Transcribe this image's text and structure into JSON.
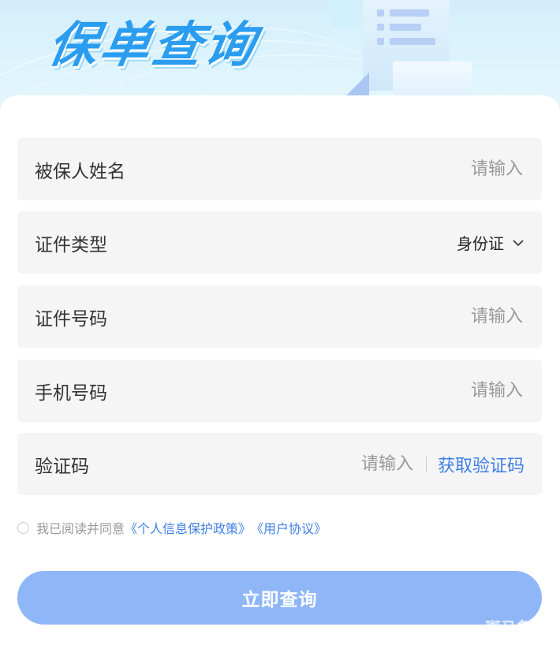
{
  "header": {
    "title": "保单查询"
  },
  "form": {
    "insured_name": {
      "label": "被保人姓名",
      "placeholder": "请输入"
    },
    "id_type": {
      "label": "证件类型",
      "value": "身份证"
    },
    "id_number": {
      "label": "证件号码",
      "placeholder": "请输入"
    },
    "phone": {
      "label": "手机号码",
      "placeholder": "请输入"
    },
    "verify_code": {
      "label": "验证码",
      "placeholder": "请输入",
      "get_code_label": "获取验证码"
    }
  },
  "agreement": {
    "checked": false,
    "prefix": "我已阅读并同意",
    "privacy_link": "《个人信息保护政策》",
    "terms_link": "《用户协议》"
  },
  "submit_label": "立即查询",
  "watermark": "斑马鲁",
  "colors": {
    "hero_bg": "#d8f0fb",
    "title": "#2a9df0",
    "field_bg": "#f5f5f5",
    "link": "#3f7fe8",
    "button": "#8fb7f8"
  }
}
